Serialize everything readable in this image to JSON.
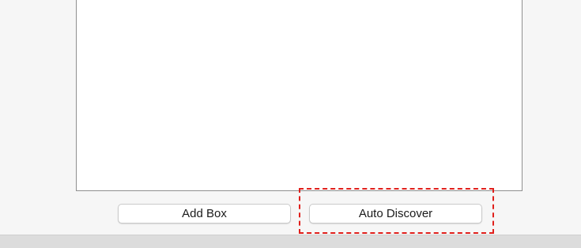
{
  "buttons": {
    "add_box_label": "Add Box",
    "auto_discover_label": "Auto Discover"
  },
  "annotation": {
    "highlight_color": "#e0201c",
    "highlight_style": "dashed"
  }
}
